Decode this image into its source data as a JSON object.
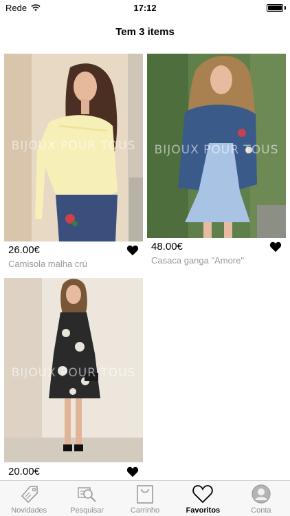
{
  "status_bar": {
    "carrier": "Rede",
    "time": "17:12"
  },
  "header": {
    "title": "Tem 3 items"
  },
  "products": [
    {
      "price": "26.00€",
      "name": "Camisola malha crú",
      "watermark": "BIJOUX POUR TOUS",
      "favorited": true
    },
    {
      "price": "48.00€",
      "name": "Casaca ganga \"Amore\"",
      "watermark": "BIJOUX POUR TOUS",
      "favorited": true
    },
    {
      "price": "20.00€",
      "name": "",
      "watermark": "BIJOUX POUR TOUS",
      "favorited": true
    }
  ],
  "tab_bar": {
    "tabs": [
      {
        "label": "Novidades",
        "icon": "price-tag-icon",
        "active": false
      },
      {
        "label": "Pesquisar",
        "icon": "search-icon",
        "active": false
      },
      {
        "label": "Carrinho",
        "icon": "shopping-bag-icon",
        "active": false
      },
      {
        "label": "Favoritos",
        "icon": "heart-icon",
        "active": true
      },
      {
        "label": "Conta",
        "icon": "user-icon",
        "active": false
      }
    ]
  },
  "colors": {
    "background": "#ffffff",
    "product_name": "#9a9a9a",
    "tab_inactive": "#8e8e8e",
    "tab_active": "#000000"
  }
}
